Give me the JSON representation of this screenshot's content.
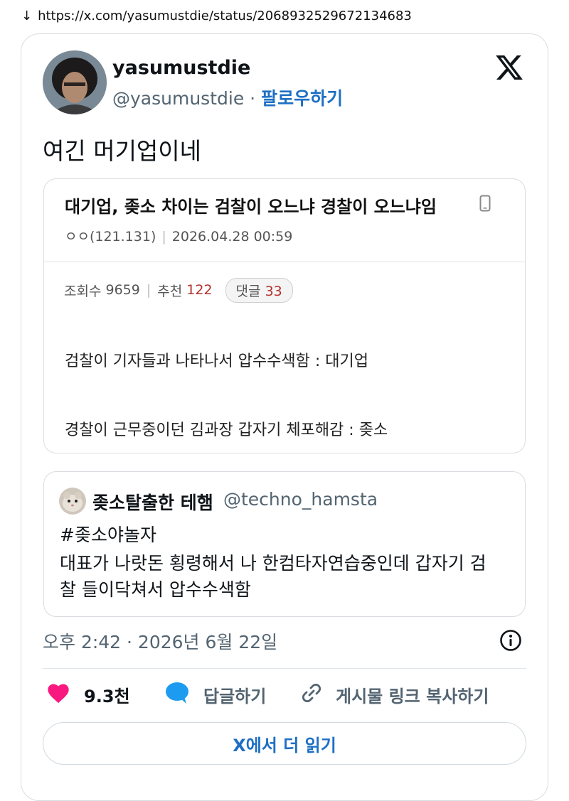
{
  "browser": {
    "url": "https://x.com/yasumustdie/status/2068932529672134683",
    "download_arrow": "↓"
  },
  "tweet": {
    "author": {
      "display_name": "yasumustdie",
      "handle": "@yasumustdie",
      "separator": " · ",
      "follow_label": "팔로우하기"
    },
    "text": "여긴 머기업이네",
    "timestamp": "오후 2:42 · 2026년 6월 22일",
    "actions": {
      "like_count": "9.3천",
      "reply_label": "답글하기",
      "copy_link_label": "게시물 링크 복사하기"
    },
    "read_more_label": "X에서 더 읽기"
  },
  "embedded_post": {
    "title": "대기업, 좆소 차이는 검찰이 오느냐 경찰이 오느냐임",
    "author": "ㅇㅇ(121.131)",
    "date": "2026.04.28 00:59",
    "views_label": "조회수",
    "views": "9659",
    "recommend_label": "추천",
    "recommend": "122",
    "comments_label": "댓글",
    "comments": "33",
    "lines": [
      "검찰이 기자들과 나타나서 압수수색함 : 대기업",
      "경찰이 근무중이던 김과장 갑자기 체포해감 : 좆소"
    ]
  },
  "quoted_tweet": {
    "display_name": "좆소탈출한 테햄",
    "handle": "@techno_hamsta",
    "lines": [
      "#좆소야놀자",
      "대표가 나랏돈 횡령해서 나 한컴타자연습중인데 갑자기 검",
      "찰 들이닥쳐서 압수수색함"
    ]
  },
  "colors": {
    "link_blue": "#1d6fc4",
    "like_pink": "#f91880",
    "reply_blue": "#1d9bf0",
    "muted_gray": "#536471",
    "count_red": "#b5312b"
  }
}
